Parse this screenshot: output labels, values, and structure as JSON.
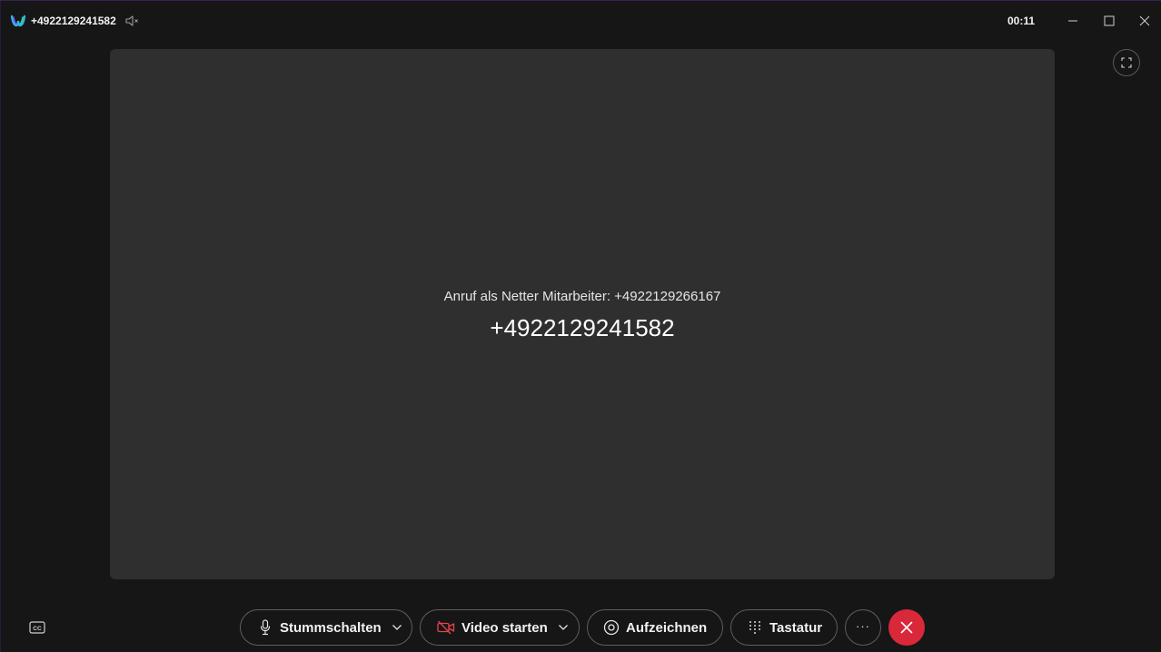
{
  "titlebar": {
    "title": "+4922129241582",
    "timer": "00:11",
    "icons": {
      "app": "webex-logo-icon",
      "speaker": "speaker-muted-icon",
      "minimize": "minimize-icon",
      "maximize": "maximize-icon",
      "close": "close-icon"
    }
  },
  "stage": {
    "calling_as": "Anruf als Netter Mitarbeiter: +4922129266167",
    "number": "+4922129241582",
    "fullscreen_icon": "fullscreen-icon"
  },
  "controls": {
    "mute_label": "Stummschalten",
    "video_label": "Video starten",
    "record_label": "Aufzeichnen",
    "keypad_label": "Tastatur",
    "more_label": "···",
    "cc_icon": "closed-captions-icon",
    "hangup_icon": "close-icon"
  },
  "colors": {
    "hangup": "#d9283a",
    "video_off_icon": "#e8424f",
    "stage_bg": "#2f2f2f",
    "window_bg": "#161616"
  }
}
